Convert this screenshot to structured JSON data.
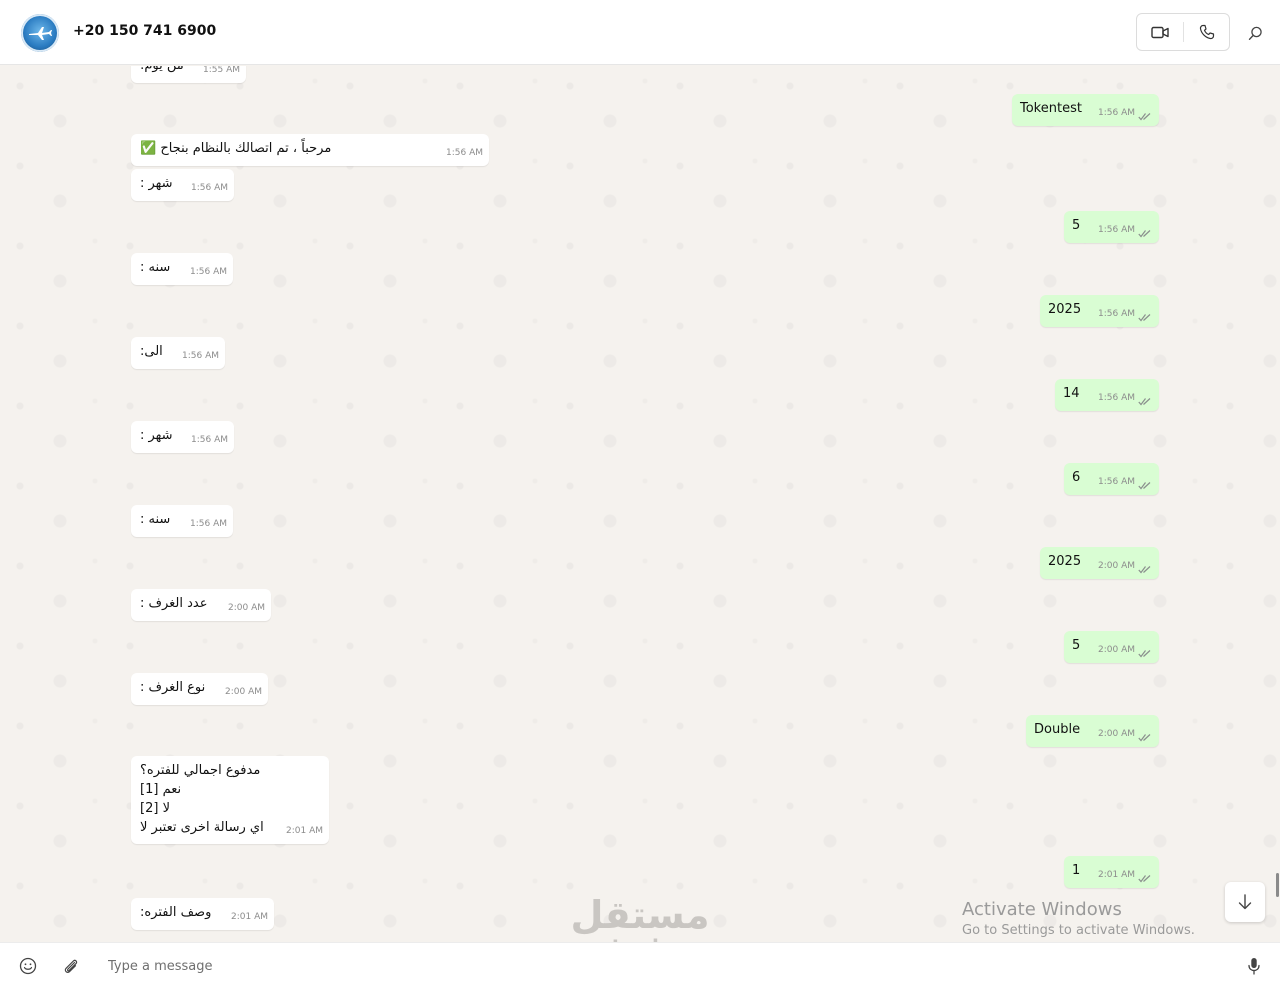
{
  "header": {
    "contact_name": "+20 150 741 6900",
    "icons": [
      "avatar",
      "video-call-icon",
      "voice-call-icon",
      "search-icon"
    ]
  },
  "messages": [
    {
      "dir": "in",
      "text": "من يوم:",
      "time": "1:55 AM"
    },
    {
      "dir": "out",
      "text": "Tokentest",
      "time": "1:56 AM"
    },
    {
      "dir": "in",
      "text": "مرحباً            ، تم اتصالك بالنظام بنجاح ✅",
      "time": "1:56 AM"
    },
    {
      "dir": "in",
      "text": "شهر :",
      "time": "1:56 AM"
    },
    {
      "dir": "out",
      "text": "5",
      "time": "1:56 AM"
    },
    {
      "dir": "in",
      "text": "سنه :",
      "time": "1:56 AM"
    },
    {
      "dir": "out",
      "text": "2025",
      "time": "1:56 AM"
    },
    {
      "dir": "in",
      "text": "الى:",
      "time": "1:56 AM"
    },
    {
      "dir": "out",
      "text": "14",
      "time": "1:56 AM"
    },
    {
      "dir": "in",
      "text": "شهر :",
      "time": "1:56 AM"
    },
    {
      "dir": "out",
      "text": "6",
      "time": "1:56 AM"
    },
    {
      "dir": "in",
      "text": "سنه :",
      "time": "1:56 AM"
    },
    {
      "dir": "out",
      "text": "2025",
      "time": "2:00 AM"
    },
    {
      "dir": "in",
      "text": "عدد الغرف :",
      "time": "2:00 AM"
    },
    {
      "dir": "out",
      "text": "5",
      "time": "2:00 AM"
    },
    {
      "dir": "in",
      "text": "نوع الغرف :",
      "time": "2:00 AM"
    },
    {
      "dir": "out",
      "text": "Double",
      "time": "2:00 AM"
    },
    {
      "dir": "in",
      "lines": [
        "مدفوع اجمالي للفتره؟",
        "نعم [1]",
        "لا [2]",
        "اي رسالة اخرى تعتبر لا"
      ],
      "time": "2:01 AM"
    },
    {
      "dir": "out",
      "text": "1",
      "time": "2:01 AM"
    },
    {
      "dir": "in",
      "text": "وصف الفتره:",
      "time": "2:01 AM"
    }
  ],
  "overlay": {
    "activate_title": "Activate Windows",
    "activate_sub": "Go to Settings to activate Windows.",
    "watermark_ar": "مستقل",
    "watermark_en": "mostaql.com"
  },
  "composer": {
    "placeholder": "Type a message",
    "value": ""
  },
  "colors": {
    "incoming_bubble": "#ffffff",
    "outgoing_bubble": "#d9fdd3",
    "chat_background": "#f5f2ee",
    "read_ticks": "#8a8f8d"
  }
}
